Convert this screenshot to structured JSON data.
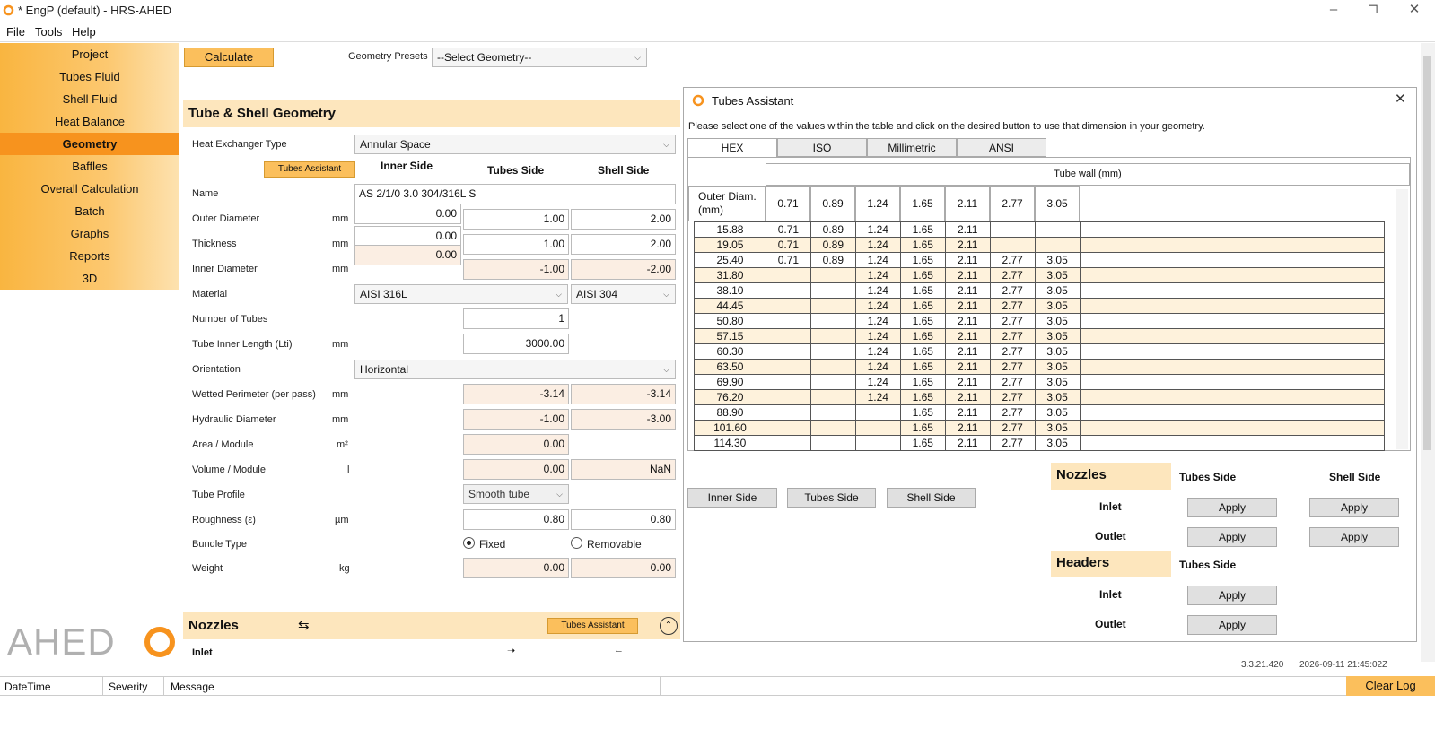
{
  "window": {
    "title": "* EngP (default) - HRS-AHED"
  },
  "menu": [
    "File",
    "Tools",
    "Help"
  ],
  "nav": [
    "Project",
    "Tubes Fluid",
    "Shell Fluid",
    "Heat Balance",
    "Geometry",
    "Baffles",
    "Overall Calculation",
    "Batch",
    "Graphs",
    "Reports",
    "3D"
  ],
  "nav_active": "Geometry",
  "logo": {
    "text": "AHED"
  },
  "toolbar": {
    "calculate": "Calculate",
    "presets_label": "Geometry Presets",
    "presets_value": "--Select Geometry--"
  },
  "geometry": {
    "title": "Tube & Shell Geometry",
    "hx_type_label": "Heat Exchanger Type",
    "hx_type_value": "Annular Space",
    "tubes_assistant": "Tubes Assistant",
    "col_inner": "Inner Side",
    "col_tubes": "Tubes Side",
    "col_shell": "Shell Side",
    "name_label": "Name",
    "name_value": "AS 2/1/0 3.0 304/316L S",
    "od_label": "Outer Diameter",
    "od_unit": "mm",
    "od_inner": "0.00",
    "od_tubes": "1.00",
    "od_shell": "2.00",
    "th_label": "Thickness",
    "th_unit": "mm",
    "th_inner": "0.00",
    "th_tubes": "1.00",
    "th_shell": "2.00",
    "id_label": "Inner Diameter",
    "id_unit": "mm",
    "id_inner": "0.00",
    "id_tubes": "-1.00",
    "id_shell": "-2.00",
    "mat_label": "Material",
    "mat_inner": "AISI 316L",
    "mat_shell": "AISI 304",
    "ntubes_label": "Number of Tubes",
    "ntubes_value": "1",
    "len_label": "Tube Inner Length (Lti)",
    "len_unit": "mm",
    "len_value": "3000.00",
    "orient_label": "Orientation",
    "orient_value": "Horizontal",
    "wp_label": "Wetted Perimeter (per pass)",
    "wp_unit": "mm",
    "wp_tubes": "-3.14",
    "wp_shell": "-3.14",
    "hd_label": "Hydraulic Diameter",
    "hd_unit": "mm",
    "hd_tubes": "-1.00",
    "hd_shell": "-3.00",
    "area_label": "Area / Module",
    "area_unit": "m²",
    "area_tubes": "0.00",
    "vol_label": "Volume / Module",
    "vol_unit": "l",
    "vol_tubes": "0.00",
    "vol_shell": "NaN",
    "profile_label": "Tube Profile",
    "profile_value": "Smooth tube",
    "rough_label": "Roughness (ε)",
    "rough_unit": "µm",
    "rough_tubes": "0.80",
    "rough_shell": "0.80",
    "bundle_label": "Bundle Type",
    "bundle_fixed": "Fixed",
    "bundle_removable": "Removable",
    "weight_label": "Weight",
    "weight_unit": "kg",
    "weight_tubes": "0.00",
    "weight_shell": "0.00"
  },
  "nozzles_section": {
    "title": "Nozzles",
    "tubes_assistant": "Tubes Assistant",
    "inlet": "Inlet"
  },
  "dialog": {
    "title": "Tubes Assistant",
    "instruction": "Please select one of the values within the table and click on the desired button to use that dimension in your geometry.",
    "tabs": [
      "HEX",
      "ISO",
      "Millimetric",
      "ANSI"
    ],
    "wall_header": "Tube wall (mm)",
    "od_header": "Outer Diam. (mm)",
    "walls": [
      "0.71",
      "0.89",
      "1.24",
      "1.65",
      "2.11",
      "2.77",
      "3.05"
    ],
    "rows": [
      [
        "15.88",
        "0.71",
        "0.89",
        "1.24",
        "1.65",
        "2.11",
        "",
        ""
      ],
      [
        "19.05",
        "0.71",
        "0.89",
        "1.24",
        "1.65",
        "2.11",
        "",
        ""
      ],
      [
        "25.40",
        "0.71",
        "0.89",
        "1.24",
        "1.65",
        "2.11",
        "2.77",
        "3.05"
      ],
      [
        "31.80",
        "",
        "",
        "1.24",
        "1.65",
        "2.11",
        "2.77",
        "3.05"
      ],
      [
        "38.10",
        "",
        "",
        "1.24",
        "1.65",
        "2.11",
        "2.77",
        "3.05"
      ],
      [
        "44.45",
        "",
        "",
        "1.24",
        "1.65",
        "2.11",
        "2.77",
        "3.05"
      ],
      [
        "50.80",
        "",
        "",
        "1.24",
        "1.65",
        "2.11",
        "2.77",
        "3.05"
      ],
      [
        "57.15",
        "",
        "",
        "1.24",
        "1.65",
        "2.11",
        "2.77",
        "3.05"
      ],
      [
        "60.30",
        "",
        "",
        "1.24",
        "1.65",
        "2.11",
        "2.77",
        "3.05"
      ],
      [
        "63.50",
        "",
        "",
        "1.24",
        "1.65",
        "2.11",
        "2.77",
        "3.05"
      ],
      [
        "69.90",
        "",
        "",
        "1.24",
        "1.65",
        "2.11",
        "2.77",
        "3.05"
      ],
      [
        "76.20",
        "",
        "",
        "1.24",
        "1.65",
        "2.11",
        "2.77",
        "3.05"
      ],
      [
        "88.90",
        "",
        "",
        "",
        "1.65",
        "2.11",
        "2.77",
        "3.05"
      ],
      [
        "101.60",
        "",
        "",
        "",
        "1.65",
        "2.11",
        "2.77",
        "3.05"
      ],
      [
        "114.30",
        "",
        "",
        "",
        "1.65",
        "2.11",
        "2.77",
        "3.05"
      ]
    ],
    "btn_inner": "Inner Side",
    "btn_tubes": "Tubes Side",
    "btn_shell": "Shell Side",
    "nozzles": "Nozzles",
    "tubes_side": "Tubes Side",
    "shell_side": "Shell Side",
    "inlet": "Inlet",
    "outlet": "Outlet",
    "apply": "Apply",
    "headers": "Headers"
  },
  "status": {
    "version": "3.3.21.420",
    "timestamp": "2026-09-11 21:45:02Z"
  },
  "log": {
    "col_datetime": "DateTime",
    "col_severity": "Severity",
    "col_message": "Message",
    "clear": "Clear Log"
  },
  "colors": {
    "accent": "#f7931e",
    "nav_bg": "#fbbf5c",
    "section_bg": "#fde6bd",
    "readonly_bg": "#fbeee3"
  }
}
